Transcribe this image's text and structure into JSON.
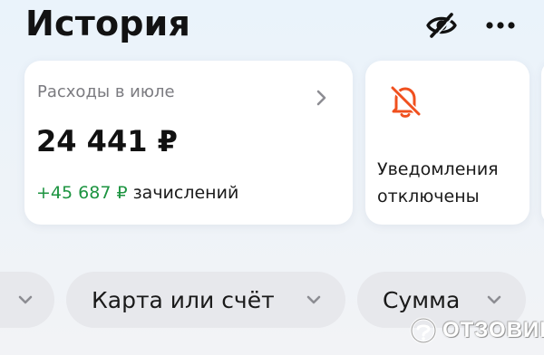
{
  "header": {
    "title": "История",
    "eye_icon": "eye-crossed-icon",
    "more_icon": "more-dots-icon"
  },
  "expenses_card": {
    "label": "Расходы в июле",
    "amount": "24 441 ₽",
    "income_amount": "+45 687 ₽",
    "income_label": "зачислений",
    "income_color": "#1d9441"
  },
  "notifications_card": {
    "label_line1": "Уведомления",
    "label_line2": "отключены",
    "icon": "bell-off-icon",
    "icon_color": "#f0501e"
  },
  "filters": [
    {
      "label": ""
    },
    {
      "label": "Карта или счёт"
    },
    {
      "label": "Сумма"
    }
  ],
  "watermark": {
    "text": "ОТЗОВИК"
  }
}
